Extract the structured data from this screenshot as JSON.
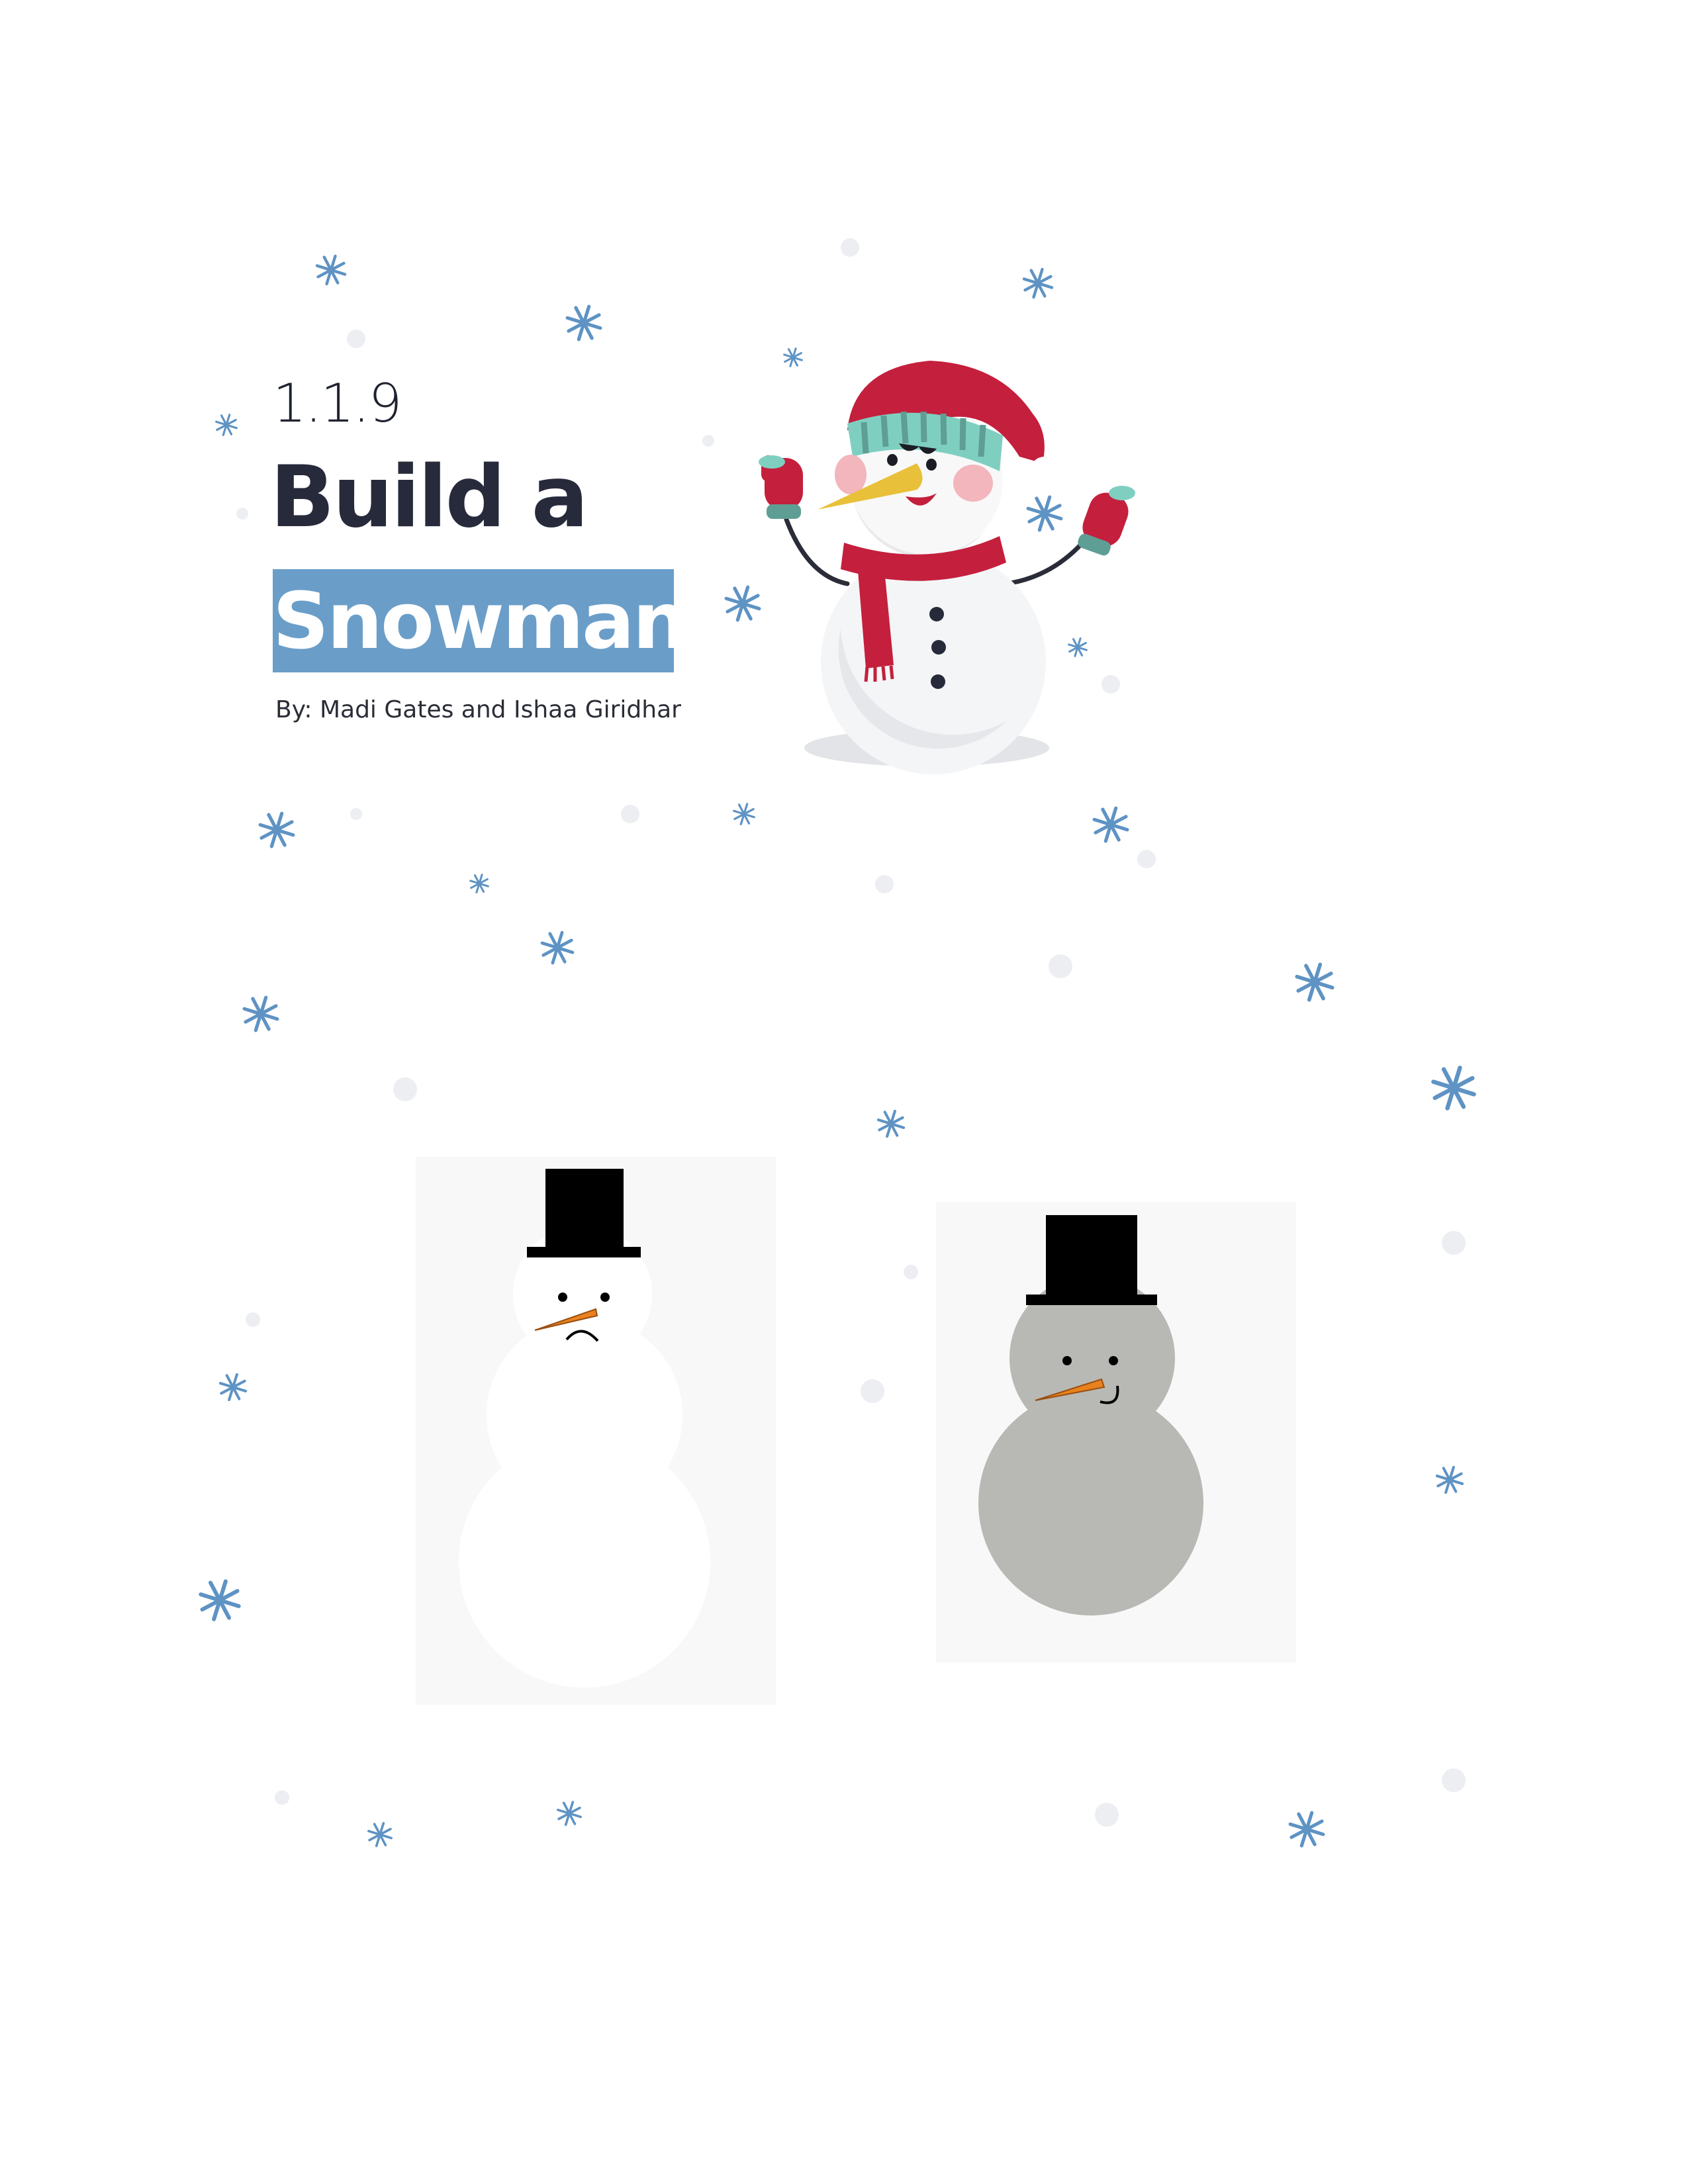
{
  "header": {
    "page_number": "1.1.9",
    "title_line1": "Build a",
    "title_line2": "Snowman",
    "byline": "By: Madi Gates and Ishaa Giridhar"
  },
  "colors": {
    "accent_blue": "#6a9ec9",
    "title_dark": "#262a3a",
    "snowflake_blue": "#5e93c4",
    "dot_gray": "#eceef2",
    "scarf_red": "#bf1e3a",
    "hat_teal": "#7fcfc1",
    "carrot_orange": "#e8821e",
    "snow_gray": "#b8b9b5",
    "panel_bg": "#f8f8f8"
  },
  "illustrations": {
    "hero": "cartoon-snowman-with-red-hat-scarf-and-mittens",
    "left_panel": "white-snowman-with-top-hat-and-frown",
    "right_panel": "gray-snowman-with-top-hat-and-smile"
  }
}
